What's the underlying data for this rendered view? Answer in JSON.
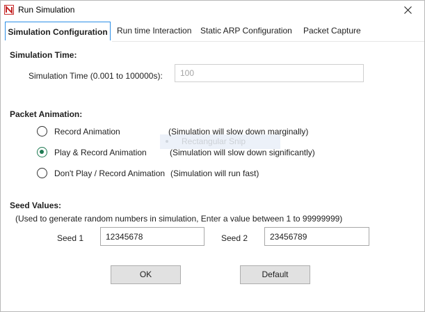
{
  "window": {
    "title": "Run Simulation",
    "icon": "netsim-logo-icon",
    "close_icon": "close-icon"
  },
  "tabs": [
    {
      "label": "Simulation Configuration",
      "active": true
    },
    {
      "label": "Run time Interaction",
      "active": false
    },
    {
      "label": "Static ARP Configuration",
      "active": false
    },
    {
      "label": "Packet Capture",
      "active": false
    }
  ],
  "simulation_time": {
    "group_title": "Simulation Time:",
    "field_label": "Simulation Time (0.001 to 100000s):",
    "value": "100",
    "enabled": false
  },
  "packet_animation": {
    "group_title": "Packet Animation:",
    "options": [
      {
        "label": "Record Animation",
        "note": "(Simulation will slow down marginally)",
        "checked": false
      },
      {
        "label": "Play & Record Animation",
        "note": "(Simulation will slow down significantly)",
        "checked": true
      },
      {
        "label": "Don't Play / Record Animation",
        "note": "(Simulation will run fast)",
        "checked": false
      }
    ]
  },
  "snip_overlay": {
    "text": "Rectangular Snip"
  },
  "seed_values": {
    "group_title": "Seed Values:",
    "hint": "(Used to generate random numbers in simulation, Enter a value between 1 to 99999999)",
    "seed1_label": "Seed 1",
    "seed1_value": "12345678",
    "seed2_label": "Seed 2",
    "seed2_value": "23456789"
  },
  "buttons": {
    "ok": "OK",
    "default": "Default"
  },
  "colors": {
    "active_tab_border": "#2b8ee6",
    "radio_checked": "#1e7a52",
    "button_face": "#e1e1e1"
  }
}
